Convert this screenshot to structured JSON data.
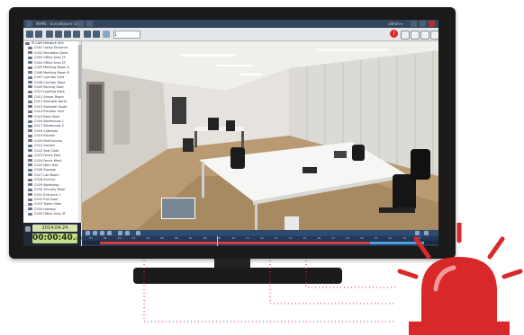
{
  "titlebar": {
    "app_title": "NVMS · Surveillance Client",
    "user": "admin ▾"
  },
  "toolbar": {
    "zoom_value": "1"
  },
  "sidebar": {
    "items": [
      "IP-CAM Network Site",
      "Ch01 Lobby Entrance",
      "Ch02 Reception Desk",
      "Ch03 Office Area 1F",
      "Ch04 Office Area 2F",
      "Ch05 Meeting Room A",
      "Ch06 Meeting Room B",
      "Ch07 Corridor East",
      "Ch08 Corridor West",
      "Ch09 Parking Gate",
      "Ch10 Loading Dock",
      "Ch11 Server Room",
      "Ch12 Stairwell North",
      "Ch13 Stairwell South",
      "Ch14 Elevator Hall",
      "Ch15 Back Door",
      "Ch16 Warehouse 1",
      "Ch17 Warehouse 2",
      "Ch18 Cafeteria",
      "Ch19 Kitchen",
      "Ch20 Roof Access",
      "Ch21 Garden",
      "Ch22 Side Gate",
      "Ch23 Fence East",
      "Ch24 Fence West",
      "Ch25 Main Hall",
      "Ch26 Storage",
      "Ch27 Lab Room",
      "Ch28 Archive",
      "Ch29 Workshop",
      "Ch30 Security Desk",
      "Ch31 Entrance 2",
      "Ch32 Exit Door",
      "Ch33 Tower View",
      "Ch34 Hallway",
      "Ch35 Office Area 3F"
    ]
  },
  "clock": {
    "date": "2014.04.24",
    "time": "00:00:40.",
    "ms": "004"
  },
  "timeline": {
    "ticks": [
      "00",
      "01",
      "02",
      "03",
      "04",
      "05",
      "06",
      "07",
      "08",
      "09",
      "10",
      "11",
      "12",
      "13",
      "14",
      "15",
      "16",
      "17",
      "18",
      "19",
      "20",
      "21",
      "22",
      "23"
    ]
  },
  "colors": {
    "accent": "#d9282a",
    "frame": "#1a1a1a",
    "chrome": "#33465d"
  },
  "icons": {
    "alarm": "siren-icon",
    "record": "record-icon"
  }
}
